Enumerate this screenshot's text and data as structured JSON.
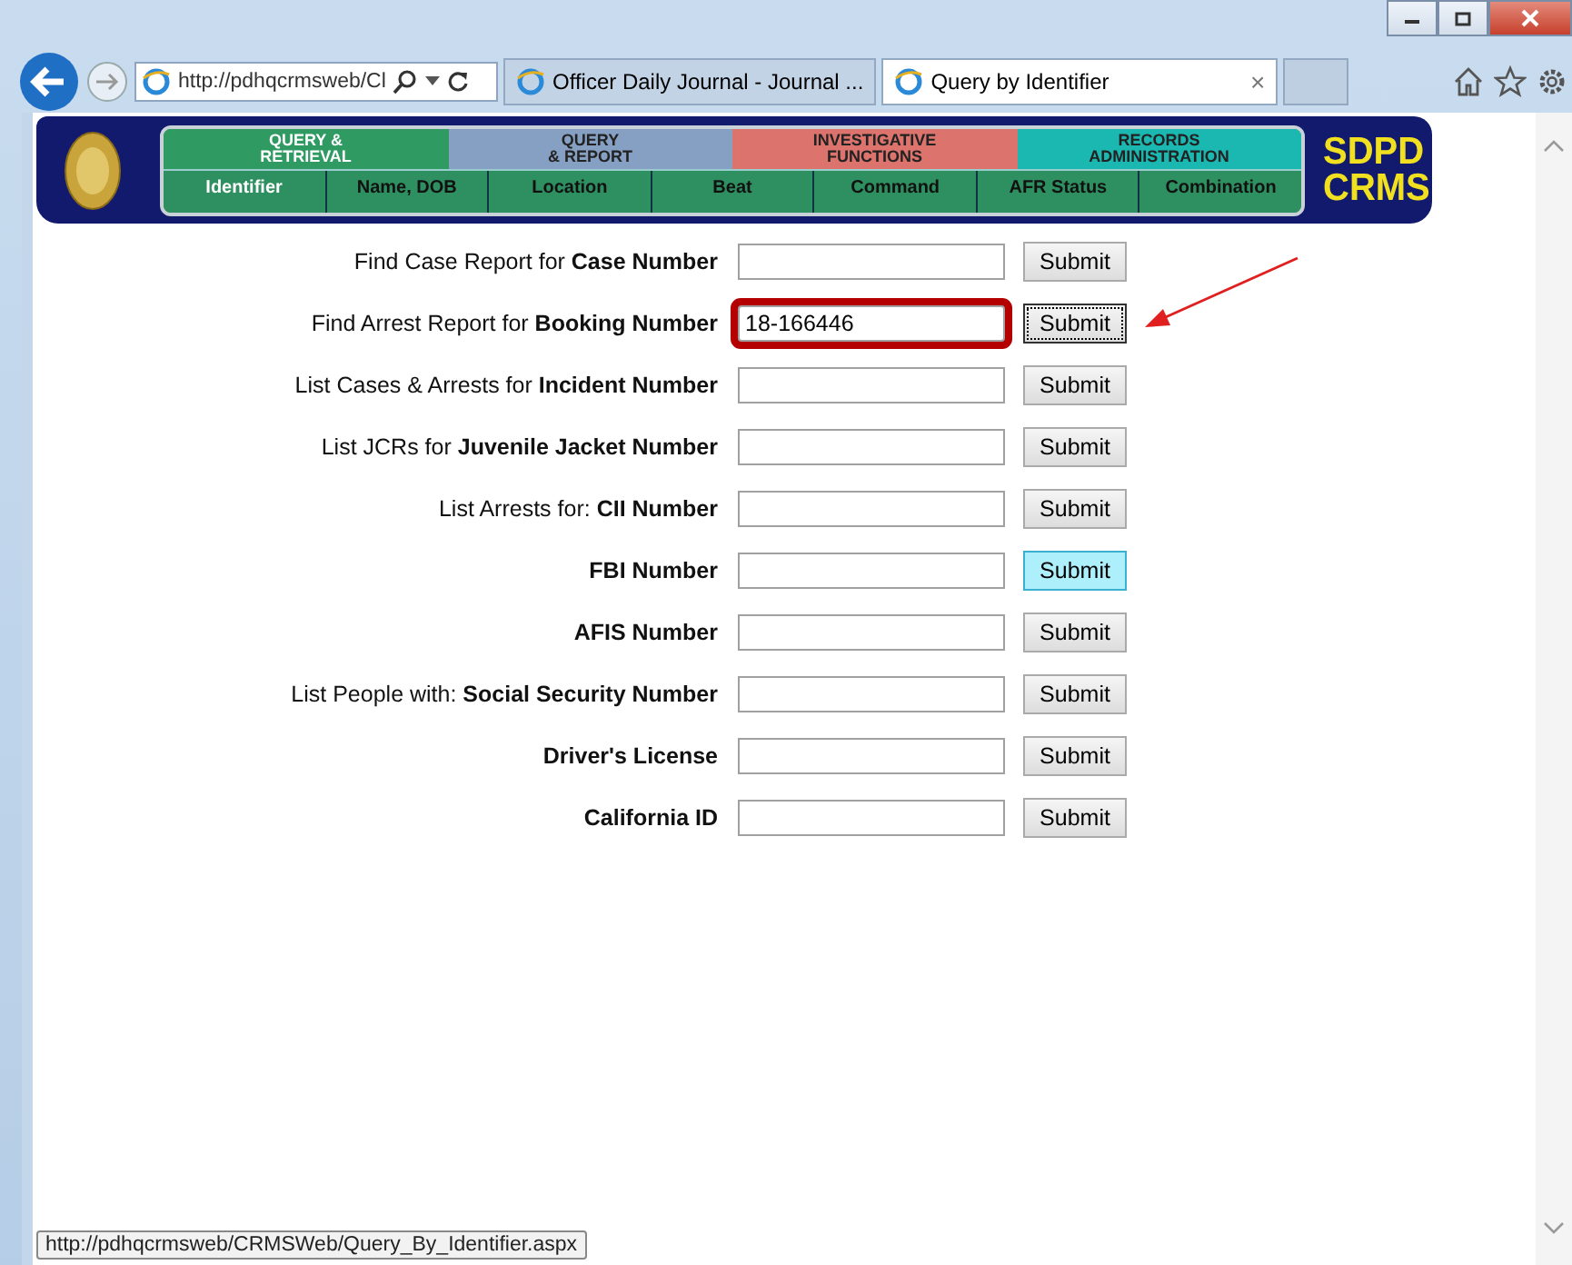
{
  "browser": {
    "address": "http://pdhqcrmsweb/Cl",
    "tabs": [
      {
        "label": "Officer Daily Journal - Journal ...",
        "selected": false
      },
      {
        "label": "Query by Identifier",
        "selected": true,
        "close": "×"
      }
    ]
  },
  "banner": {
    "categories": [
      {
        "label": "QUERY &\nRETRIEVAL",
        "color": "#2f9a62"
      },
      {
        "label": "QUERY\n& REPORT",
        "color": "#86a0c4"
      },
      {
        "label": "INVESTIGATIVE\nFUNCTIONS",
        "color": "#dc736c"
      },
      {
        "label": "RECORDS\nADMINISTRATION",
        "color": "#1bb7b1"
      }
    ],
    "subitems": [
      {
        "label": "Identifier",
        "selected": true
      },
      {
        "label": "Name, DOB",
        "selected": false
      },
      {
        "label": "Location",
        "selected": false
      },
      {
        "label": "Beat",
        "selected": false
      },
      {
        "label": "Command",
        "selected": false
      },
      {
        "label": "AFR Status",
        "selected": false
      },
      {
        "label": "Combination",
        "selected": false
      }
    ],
    "logo": [
      "SDPD",
      "CRMS"
    ]
  },
  "rows": [
    {
      "label": "Find Case Report for **Case Number**",
      "value": "",
      "highlighted": false,
      "button": {
        "label": "Submit",
        "focused": false,
        "hovered": false
      }
    },
    {
      "label": "Find Arrest Report for **Booking Number**",
      "value": "18-166446",
      "highlighted": true,
      "button": {
        "label": "Submit",
        "focused": true,
        "hovered": false
      }
    },
    {
      "label": "List Cases & Arrests for **Incident Number**",
      "value": "",
      "highlighted": false,
      "button": {
        "label": "Submit",
        "focused": false,
        "hovered": false
      }
    },
    {
      "label": "List JCRs for **Juvenile Jacket Number**",
      "value": "",
      "highlighted": false,
      "button": {
        "label": "Submit",
        "focused": false,
        "hovered": false
      }
    },
    {
      "label": "List Arrests for: **CII Number**",
      "value": "",
      "highlighted": false,
      "button": {
        "label": "Submit",
        "focused": false,
        "hovered": false
      }
    },
    {
      "label": "**FBI Number**",
      "value": "",
      "highlighted": false,
      "button": {
        "label": "Submit",
        "focused": false,
        "hovered": true
      }
    },
    {
      "label": "**AFIS Number**",
      "value": "",
      "highlighted": false,
      "button": {
        "label": "Submit",
        "focused": false,
        "hovered": false
      }
    },
    {
      "label": "List People with: **Social Security Number**",
      "value": "",
      "highlighted": false,
      "button": {
        "label": "Submit",
        "focused": false,
        "hovered": false
      }
    },
    {
      "label": "**Driver's License**",
      "value": "",
      "highlighted": false,
      "button": {
        "label": "Submit",
        "focused": false,
        "hovered": false
      }
    },
    {
      "label": "**California ID**",
      "value": "",
      "highlighted": false,
      "button": {
        "label": "Submit",
        "focused": false,
        "hovered": false
      }
    }
  ],
  "status_url": "http://pdhqcrmsweb/CRMSWeb/Query_By_Identifier.aspx"
}
